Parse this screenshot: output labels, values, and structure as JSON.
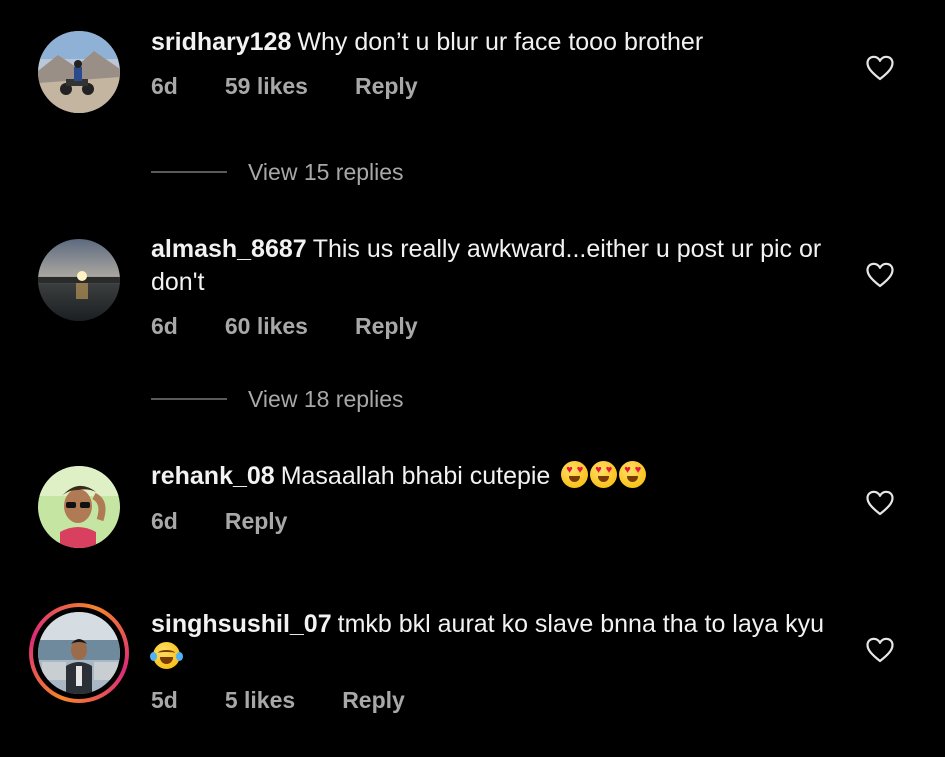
{
  "comments": [
    {
      "username": "sridhary128",
      "text": "Why don’t u blur ur face tooo brother",
      "time": "6d",
      "likes": "59 likes",
      "reply": "Reply",
      "view_replies": "View 15 replies",
      "avatar": "motorcycle-rider-photo"
    },
    {
      "username": "almash_8687",
      "text": "This us really awkward...either u post ur pic or don't",
      "time": "6d",
      "likes": "60 likes",
      "reply": "Reply",
      "view_replies": "View 18 replies",
      "avatar": "sunset-lake-photo"
    },
    {
      "username": "rehank_08",
      "text": "Masaallah bhabi cutepie",
      "emojis": [
        "heart-eyes",
        "heart-eyes",
        "heart-eyes"
      ],
      "time": "6d",
      "reply": "Reply",
      "avatar": "man-sunglasses-photo"
    },
    {
      "username": "singhsushil_07",
      "text": "tmkb bkl aurat ko slave bnna tha to laya kyu",
      "emojis": [
        "face-with-tears-of-joy"
      ],
      "time": "5d",
      "likes": "5 likes",
      "reply": "Reply",
      "avatar": "man-standing-photo",
      "has_story_ring": true
    }
  ],
  "icons": {
    "like": "heart-outline-icon"
  },
  "colors": {
    "background": "#000000",
    "primary_text": "#f2f2f2",
    "secondary_text": "#a8a8a8",
    "story_ring": "#dd2a7b"
  }
}
